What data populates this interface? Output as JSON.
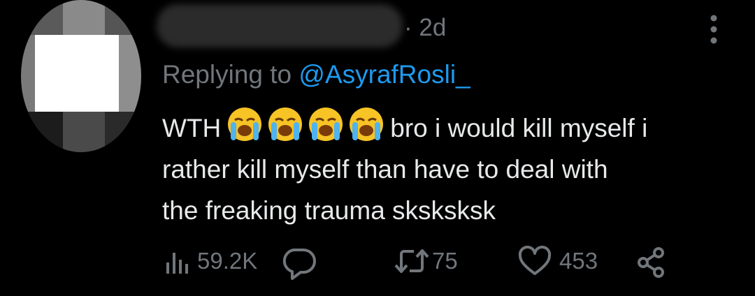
{
  "tweet": {
    "time_meta": "· 2d",
    "replying_prefix": "Replying to",
    "replying_handle": "@AsyrafRosli_",
    "text_line1_a": "WTH",
    "text_line1_b": "bro i would kill myself i",
    "text_line2": "rather kill myself than have to deal with",
    "text_line3": "the freaking trauma sksksksk",
    "emoji": "loudly-crying-face",
    "emoji_count": 4
  },
  "actions": {
    "views": "59.2K",
    "retweets": "75",
    "likes": "453"
  },
  "colors": {
    "background": "#000000",
    "text": "#e7e9ea",
    "muted": "#71767b",
    "link": "#1d9bf0"
  }
}
